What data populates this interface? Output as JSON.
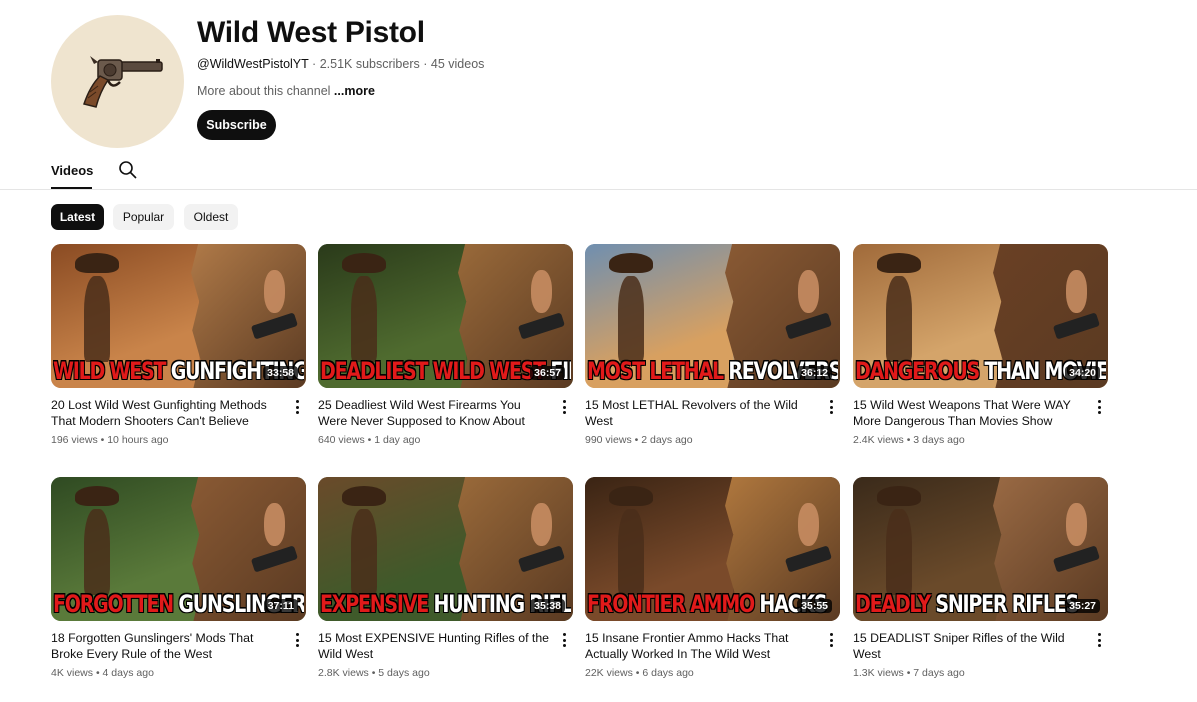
{
  "channel": {
    "name": "Wild West Pistol",
    "handle": "@WildWestPistolYT",
    "subscribers": "2.51K subscribers",
    "video_count": "45 videos",
    "separator": "·",
    "about": "More about this channel",
    "more_link": "...more",
    "subscribe_label": "Subscribe"
  },
  "tabs": {
    "videos": "Videos"
  },
  "chips": [
    "Latest",
    "Popular",
    "Oldest"
  ],
  "videos": [
    {
      "title": "20 Lost Wild West Gunfighting Methods That Modern Shooters Can't Believe",
      "views": "196 views",
      "age": "10 hours ago",
      "duration": "33:58",
      "cap_red": "WILD WEST",
      "cap_white": "GUNFIGHTING METHODS"
    },
    {
      "title": "25 Deadliest Wild West Firearms You Were Never Supposed to Know About",
      "views": "640 views",
      "age": "1 day ago",
      "duration": "36:57",
      "cap_red": "DEADLIEST WILD WEST",
      "cap_white": "FIREARMS"
    },
    {
      "title": "15 Most LETHAL Revolvers of the Wild West",
      "views": "990 views",
      "age": "2 days ago",
      "duration": "36:12",
      "cap_red": "MOST LETHAL",
      "cap_white": "REVOLVERS"
    },
    {
      "title": "15 Wild West Weapons That Were WAY More Dangerous Than Movies Show",
      "views": "2.4K views",
      "age": "3 days ago",
      "duration": "34:20",
      "cap_red": "DANGEROUS",
      "cap_white": "THAN MOVIES SHOW"
    },
    {
      "title": "18 Forgotten Gunslingers' Mods That Broke Every Rule of the West",
      "views": "4K views",
      "age": "4 days ago",
      "duration": "37:11",
      "cap_red": "FORGOTTEN",
      "cap_white": "GUNSLINGERS MODS"
    },
    {
      "title": "15 Most EXPENSIVE Hunting Rifles of the Wild West",
      "views": "2.8K views",
      "age": "5 days ago",
      "duration": "35:38",
      "cap_red": "EXPENSIVE",
      "cap_white": "HUNTING RIFLES"
    },
    {
      "title": "15 Insane Frontier Ammo Hacks That Actually Worked In The Wild West",
      "views": "22K views",
      "age": "6 days ago",
      "duration": "35:55",
      "cap_red": "FRONTIER AMMO",
      "cap_white": "HACKS"
    },
    {
      "title": "15 DEADLIST Sniper Rifles of the Wild West",
      "views": "1.3K views",
      "age": "7 days ago",
      "duration": "35:27",
      "cap_red": "DEADLY",
      "cap_white": "SNIPER RIFLES"
    }
  ],
  "colors": {
    "accent": "#0f0f0f",
    "caption_red": "#e11a1a",
    "avatar_bg": "#efe4cf"
  },
  "icons": {
    "avatar": "revolver-icon",
    "search": "search-icon",
    "menu": "more-vert-icon"
  }
}
